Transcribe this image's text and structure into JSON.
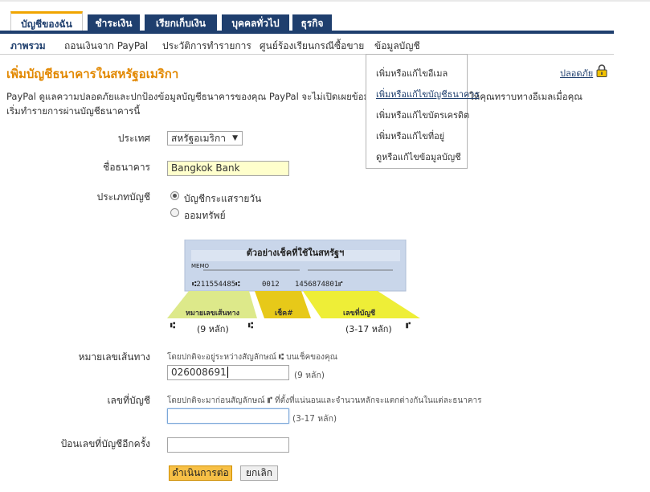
{
  "tabs": [
    "บัญชีของฉัน",
    "ชำระเงิน",
    "เรียกเก็บเงิน",
    "บุคคลทั่วไป",
    "ธุรกิจ"
  ],
  "subnav": [
    "ภาพรวม",
    "ถอนเงินจาก PayPal",
    "ประวัติการทำรายการ",
    "ศูนย์ร้องเรียนกรณีซื้อขาย",
    "ข้อมูลบัญชี"
  ],
  "dropdown": [
    "เพิ่มหรือแก้ไขอีเมล",
    "เพิ่มหรือแก้ไขบัญชีธนาคาร",
    "เพิ่มหรือแก้ไขบัตรเครดิต",
    "เพิ่มหรือแก้ไขที่อยู่",
    "ดูหรือแก้ไขข้อมูลบัญชี"
  ],
  "page": {
    "title": "เพิ่มบัญชีธนาคารในสหรัฐอเมริกา",
    "secure_link": "ปลอดภัย",
    "intro_line1": "PayPal ดูแลความปลอดภัยและปกป้องข้อมูลบัญชีธนาคารของคุณ PayPal จะไม่เปิดเผยข้อมู",
    "intro_line1_tail": "ให้คุณทราบทางอีเมลเมื่อคุณ",
    "intro_line2": "เริ่มทำรายการผ่านบัญชีธนาคารนี้"
  },
  "form": {
    "country_label": "ประเทศ",
    "country_value": "สหรัฐอเมริกา",
    "bank_name_label": "ชื่อธนาคาร",
    "bank_name_value": "Bangkok Bank",
    "account_type_label": "ประเภทบัญชี",
    "account_type_options": [
      "บัญชีกระแสรายวัน",
      "ออมทรัพย์"
    ],
    "routing_label": "หมายเลขเส้นทาง",
    "routing_hint": "โดยปกติจะอยู่ระหว่างสัญลักษณ์",
    "routing_hint_tail": "บนเช็คของคุณ",
    "routing_value": "026008691",
    "routing_suffix": "(9 หลัก)",
    "account_label": "เลขที่บัญชี",
    "account_hint": "โดยปกติจะมาก่อนสัญลักษณ์",
    "account_hint_tail": "ที่ตั้งที่แน่นอนและจำนวนหลักจะแตกต่างกันในแต่ละธนาคาร",
    "account_value": "",
    "account_suffix": "(3-17 หลัก)",
    "reenter_label": "ป้อนเลขที่บัญชีอีกครั้ง",
    "reenter_value": "",
    "continue_button": "ดำเนินการต่อ",
    "cancel_button": "ยกเลิก"
  },
  "cheque": {
    "title": "ตัวอย่างเช็คที่ใช้ในสหรัฐฯ",
    "memo": "MEMO",
    "micr_routing": "⑆211554485⑆",
    "micr_check": "0012",
    "micr_account": "1456874801⑈",
    "routing_label": "หมายเลขเส้นทาง",
    "check_label": "เช็ค#",
    "account_label": "เลขที่บัญชี",
    "routing_count": "(9 หลัก)",
    "account_count": "(3-17 หลัก)",
    "routing_symbol": "⑆",
    "account_symbol": "⑈"
  }
}
